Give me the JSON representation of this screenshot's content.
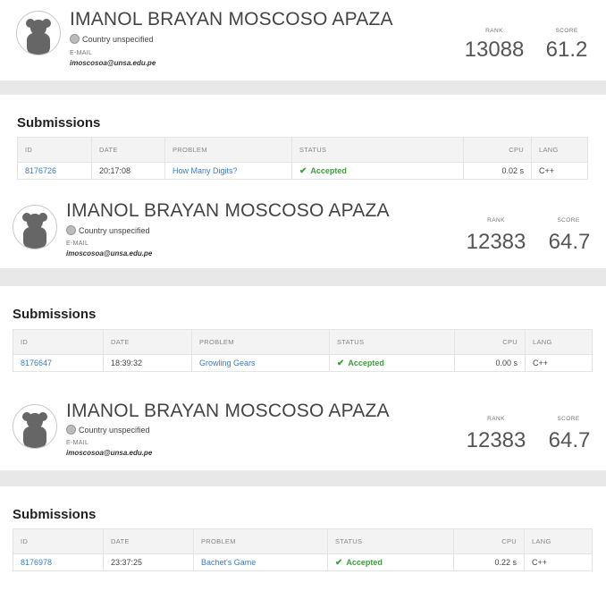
{
  "profile": {
    "name": "IMANOL BRAYAN MOSCOSO APAZA",
    "country": "Country unspecified",
    "email_label": "E-MAIL",
    "email": "imoscosoa@unsa.edu.pe",
    "rank_label": "RANK",
    "score_label": "SCORE"
  },
  "submissions_title": "Submissions",
  "columns": {
    "id": "ID",
    "date": "DATE",
    "problem": "PROBLEM",
    "status": "STATUS",
    "cpu": "CPU",
    "lang": "LANG"
  },
  "snapshots": [
    {
      "rank": "13088",
      "score": "61.2",
      "row": {
        "id": "8176726",
        "date": "20:17:08",
        "problem": "How Many Digits?",
        "status": "Accepted",
        "cpu": "0.02 s",
        "lang": "C++"
      }
    },
    {
      "rank": "12383",
      "score": "64.7",
      "row": {
        "id": "8176647",
        "date": "18:39:32",
        "problem": "Growling Gears",
        "status": "Accepted",
        "cpu": "0.00 s",
        "lang": "C++"
      }
    },
    {
      "rank": "12383",
      "score": "64.7",
      "row": {
        "id": "8176978",
        "date": "23:37:25",
        "problem": "Bachet's Game",
        "status": "Accepted",
        "cpu": "0.22 s",
        "lang": "C++"
      }
    }
  ],
  "colors": {
    "link": "#3b7dc4",
    "accepted": "#3aa33a",
    "band": "#e8e8e8"
  }
}
